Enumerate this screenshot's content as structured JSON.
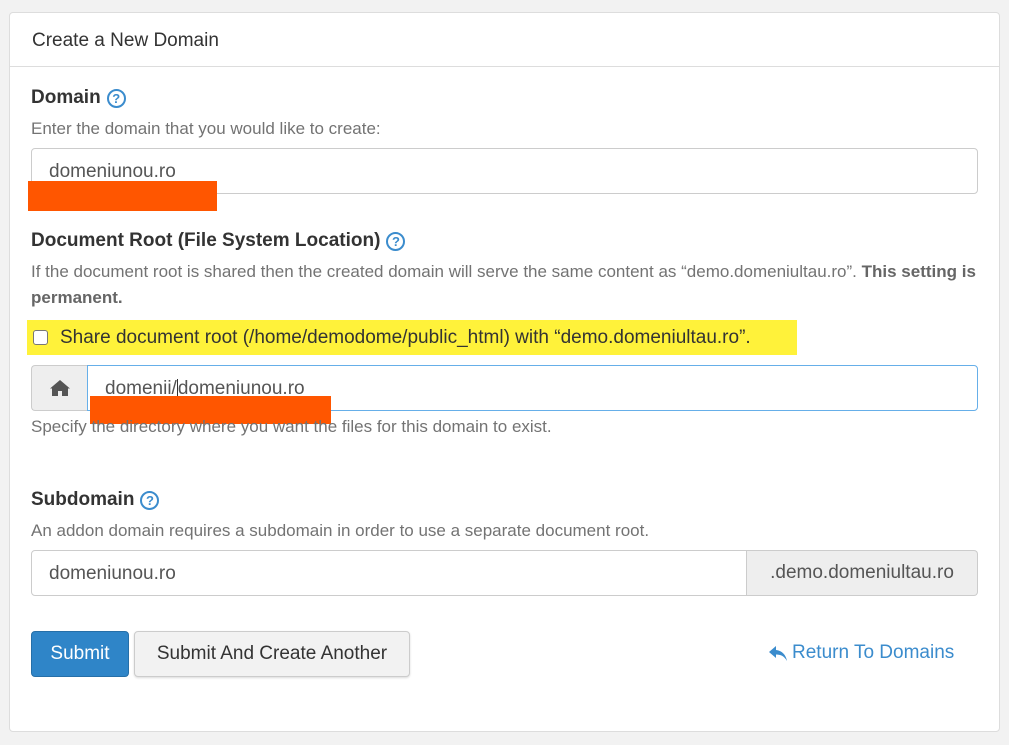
{
  "panel": {
    "title": "Create a New Domain"
  },
  "domain": {
    "label": "Domain",
    "help": "Enter the domain that you would like to create:",
    "value": "domeniunou.ro"
  },
  "docroot": {
    "label": "Document Root (File System Location)",
    "help_prefix": "If the document root is shared then the created domain will serve the same content as “demo.domeniultau.ro”.",
    "help_bold": "This setting is permanent.",
    "share_label": "Share document root (/home/demodome/public_html) with “demo.domeniultau.ro”.",
    "share_checked": false,
    "value_prefix": "domenii/",
    "value_suffix": "domeniunou.ro",
    "help_after": "Specify the directory where you want the files for this domain to exist."
  },
  "subdomain": {
    "label": "Subdomain",
    "help": "An addon domain requires a subdomain in order to use a separate document root.",
    "value": "domeniunou.ro",
    "suffix": ".demo.domeniultau.ro"
  },
  "actions": {
    "submit": "Submit",
    "submit_another": "Submit And Create Another",
    "return": "Return To Domains"
  },
  "colors": {
    "primary": "#2f85c8",
    "link": "#3b8ccd",
    "redaction": "#ff5600",
    "highlight": "#fff23a"
  },
  "icons": {
    "help": "question-circle-icon",
    "home": "home-icon",
    "return": "reply-arrow-icon"
  }
}
